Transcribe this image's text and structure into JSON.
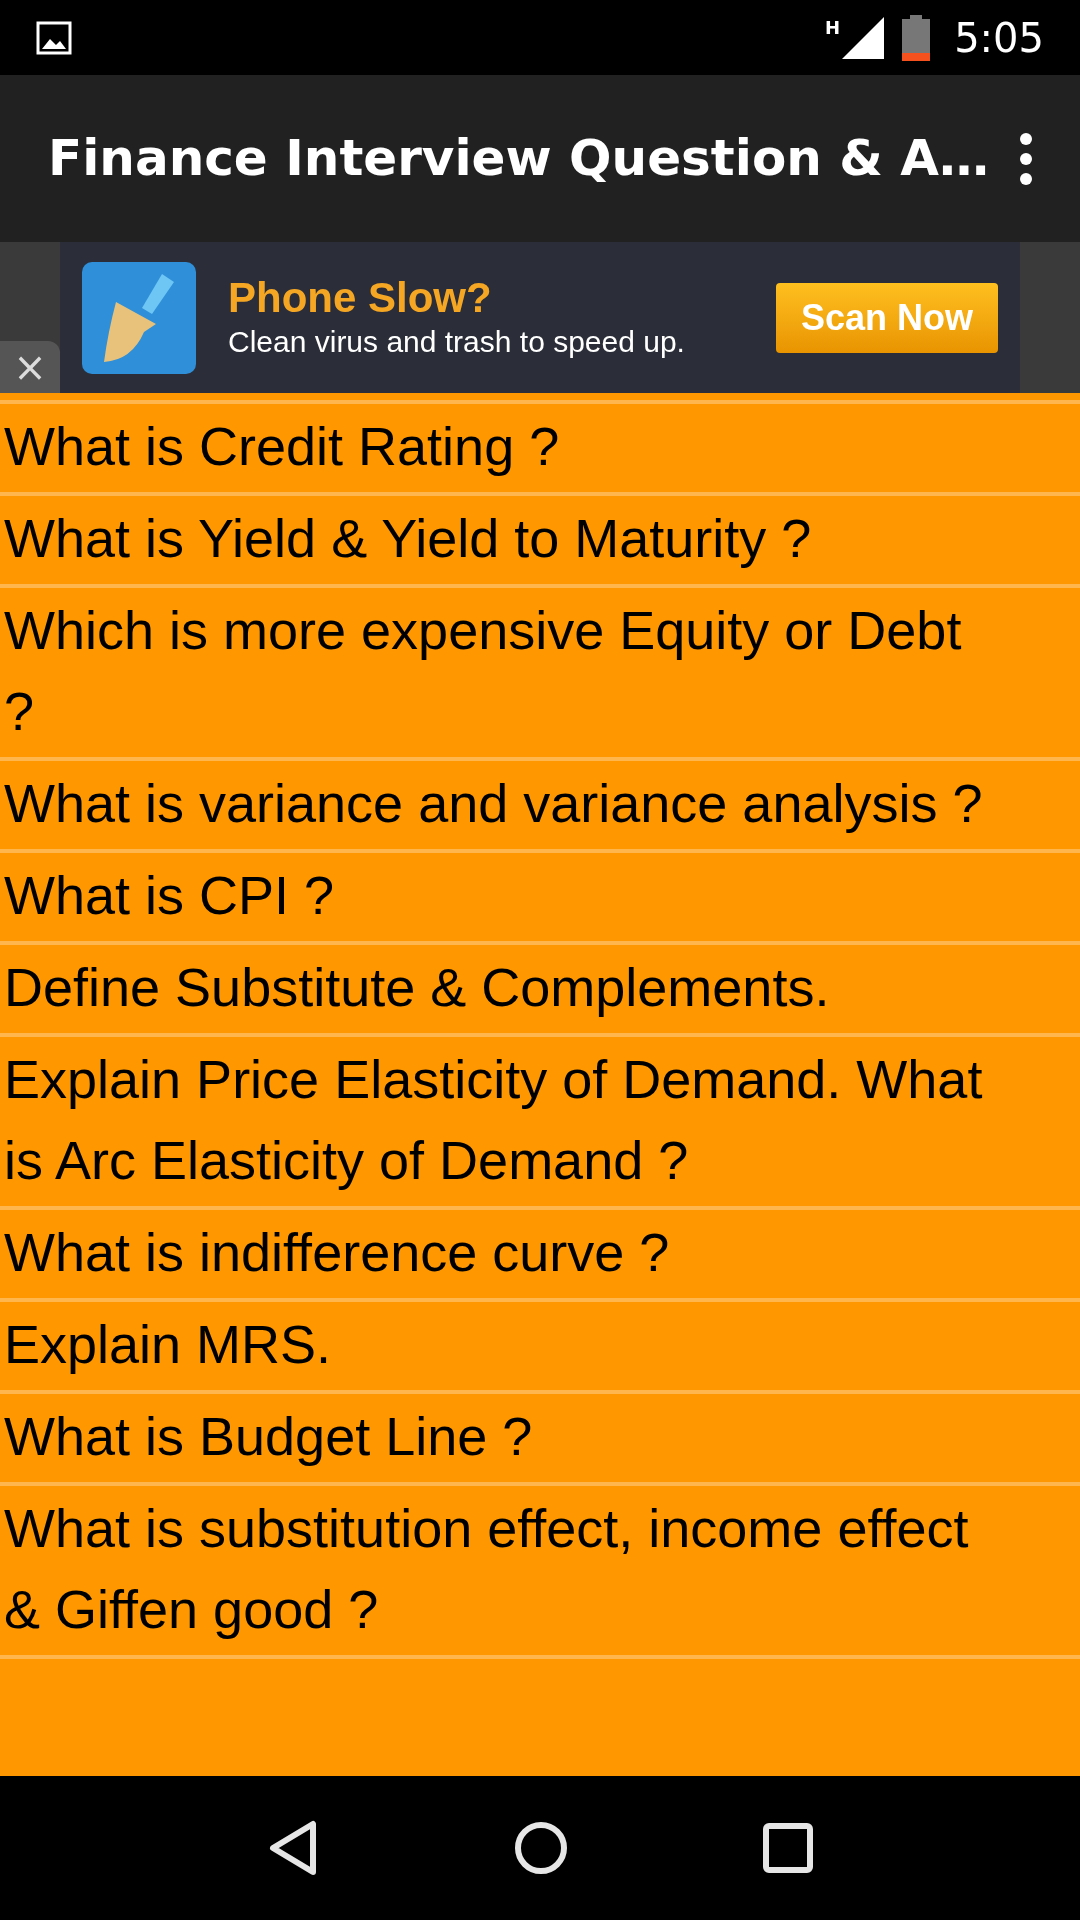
{
  "status_bar": {
    "network": "H",
    "time": "5:05"
  },
  "app_bar": {
    "title": "Finance Interview Question & A…"
  },
  "ad": {
    "close": "×",
    "headline": "Phone Slow?",
    "text": "Clean virus and trash to speed up.",
    "button": "Scan Now"
  },
  "questions": [
    {
      "text": "What is Credit Rating ?"
    },
    {
      "text": "What is Yield & Yield to Maturity ?"
    },
    {
      "text": "Which is more expensive Equity or Debt ?"
    },
    {
      "text": "What is variance and variance analysis ?"
    },
    {
      "text": "What is CPI ?"
    },
    {
      "text": "Define Substitute & Complements."
    },
    {
      "text": "Explain Price Elasticity of Demand. What is Arc Elasticity of Demand ?"
    },
    {
      "text": "What is indifference curve ?"
    },
    {
      "text": "Explain MRS."
    },
    {
      "text": "What is Budget Line ?"
    },
    {
      "text": "What is substitution effect, income effect & Giffen good ?"
    }
  ]
}
